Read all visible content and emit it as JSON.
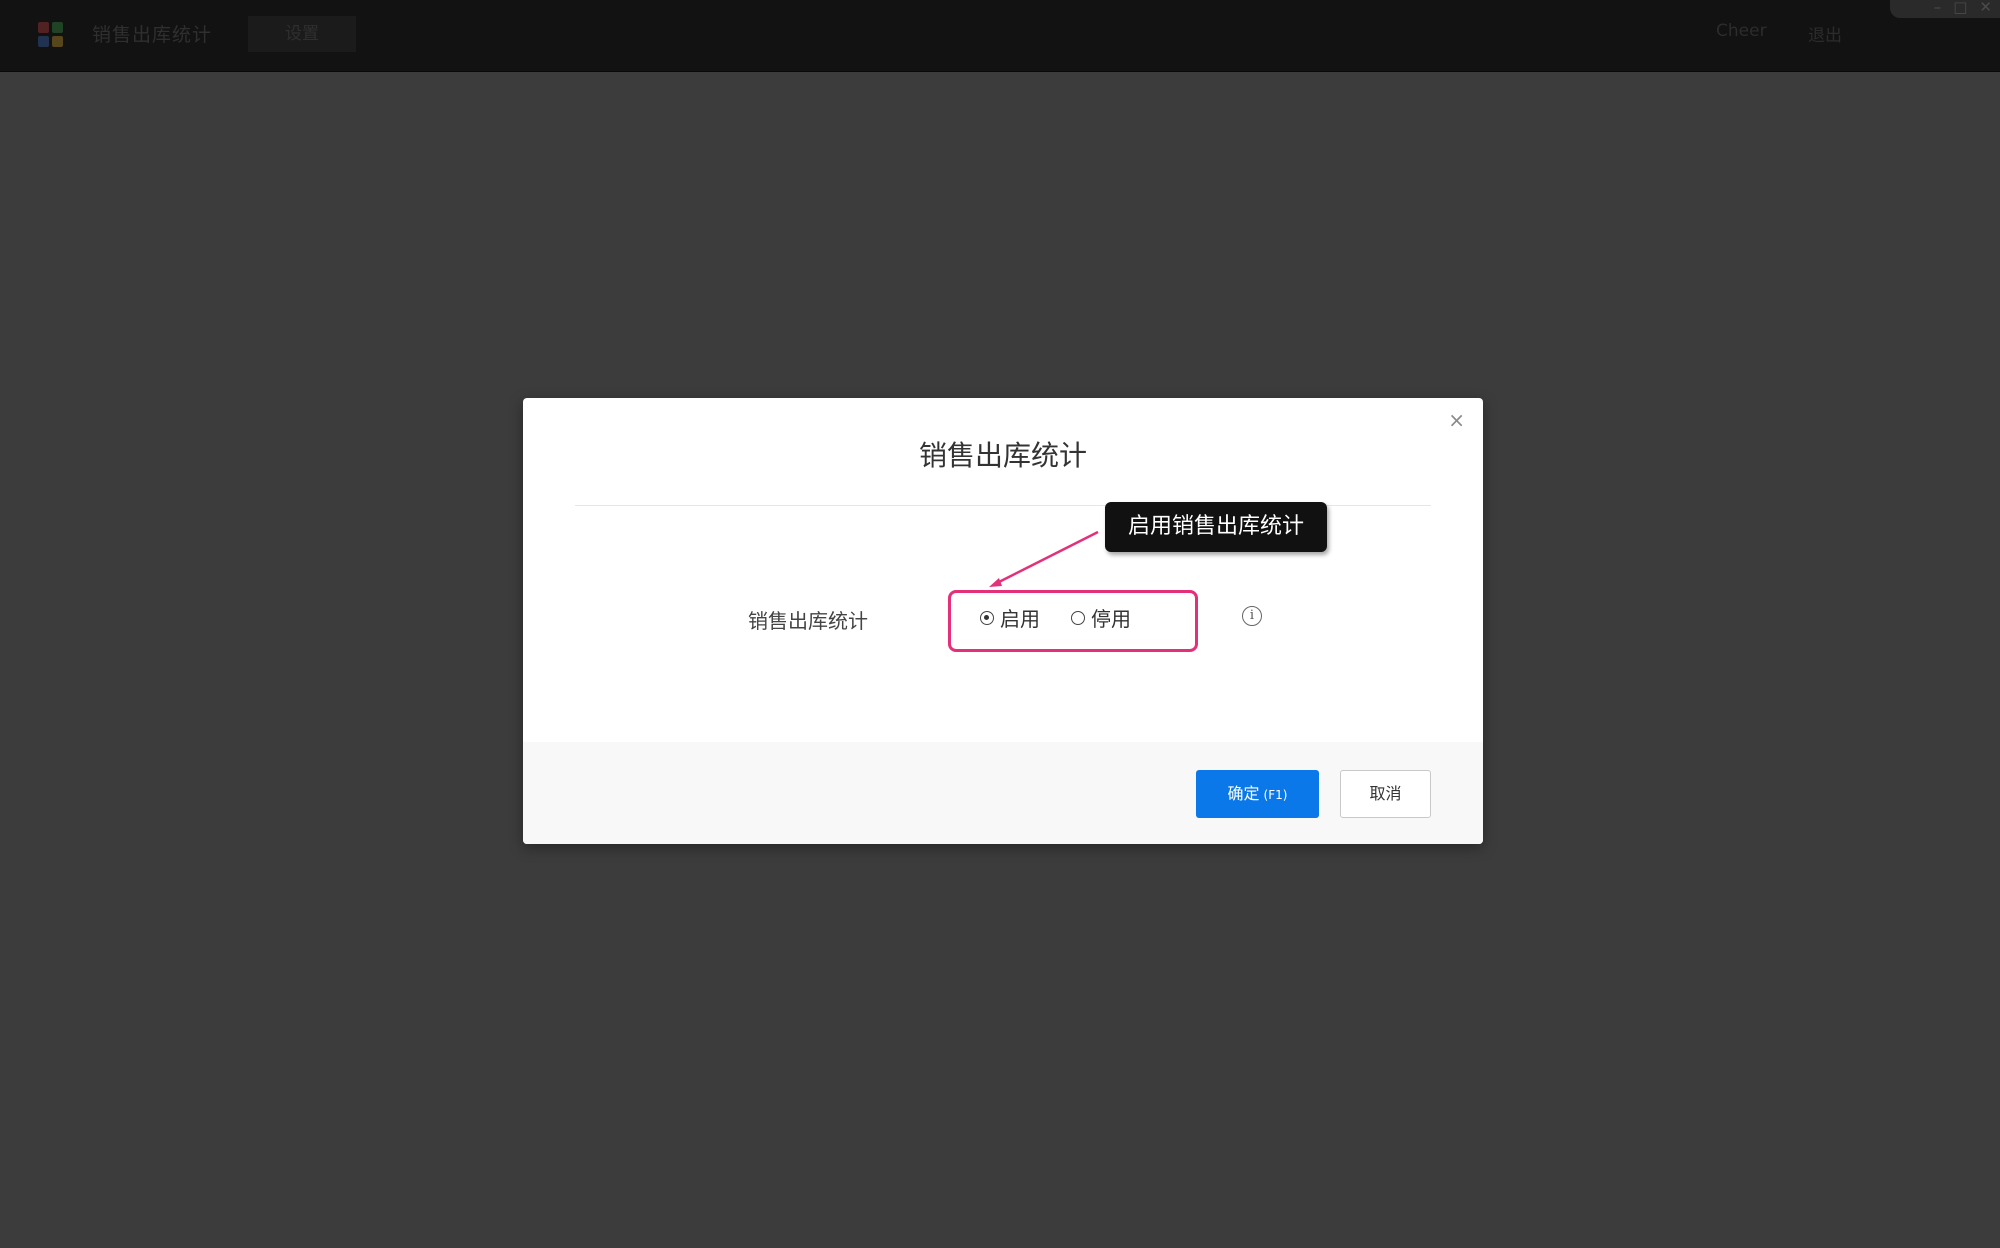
{
  "topbar": {
    "app_title": "销售出库统计",
    "settings_tab": "设置",
    "user_name": "Cheer",
    "logout": "退出"
  },
  "dialog": {
    "title": "销售出库统计",
    "close_symbol": "×",
    "field_label": "销售出库统计",
    "options": [
      {
        "label": "启用",
        "selected": true
      },
      {
        "label": "停用",
        "selected": false
      }
    ],
    "info_symbol": "i",
    "tooltip": "启用销售出库统计",
    "confirm_label": "确定",
    "confirm_key": "(F1)",
    "cancel_label": "取消"
  },
  "colors": {
    "overlay": "#3c3c3c",
    "highlight": "#e4307a",
    "primary": "#0a78e8"
  }
}
